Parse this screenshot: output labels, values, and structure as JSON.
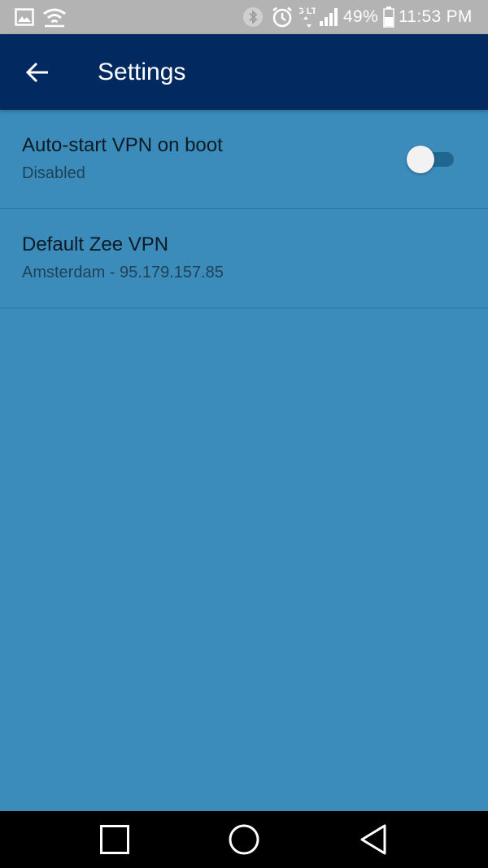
{
  "status_bar": {
    "battery_percent": "49%",
    "time": "11:53 PM",
    "network_label": "4G LTE",
    "icons": [
      "gallery-icon",
      "wifi-hotspot-icon",
      "bluetooth-icon",
      "alarm-icon",
      "network-4g-lte-icon",
      "signal-icon",
      "battery-icon"
    ]
  },
  "app_bar": {
    "title": "Settings",
    "back_icon": "arrow-back-icon"
  },
  "settings": {
    "items": [
      {
        "title": "Auto-start VPN on boot",
        "summary": "Disabled",
        "toggle_on": false
      },
      {
        "title": "Default Zee VPN",
        "summary": "Amsterdam - 95.179.157.85"
      }
    ]
  },
  "nav_bar": {
    "icons": [
      "recent-apps-icon",
      "home-icon",
      "back-icon"
    ]
  },
  "colors": {
    "status_bar": "#b3b3b3",
    "app_bar": "#022a60",
    "background": "#3b8cbb",
    "divider": "#2d74a0",
    "toggle_track": "#1f6790",
    "toggle_thumb": "#f2f2f2",
    "nav_bar": "#000000"
  }
}
